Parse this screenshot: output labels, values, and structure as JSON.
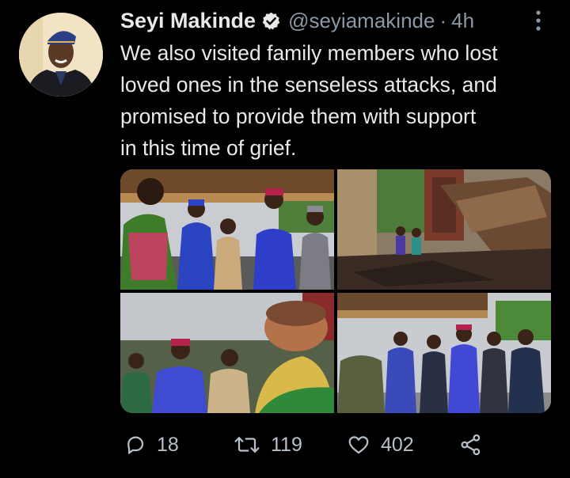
{
  "tweet": {
    "author_name": "Seyi Makinde",
    "handle": "@seyiamakinde",
    "separator": "·",
    "time": "4h",
    "text_lines": [
      "We also visited family members who lost",
      "loved ones in the senseless attacks, and",
      "promised to provide them with support",
      "in this time of grief."
    ],
    "photos_count": 4
  },
  "actions": {
    "reply_count": "18",
    "retweet_count": "119",
    "like_count": "402"
  },
  "icons": {
    "verified": "verified-badge-icon",
    "more": "more-vertical-icon",
    "reply": "reply-icon",
    "retweet": "retweet-icon",
    "like": "heart-icon",
    "share": "share-icon"
  },
  "colors": {
    "background": "#000000",
    "text": "#e7e9ea",
    "secondary": "#8b98a5"
  }
}
